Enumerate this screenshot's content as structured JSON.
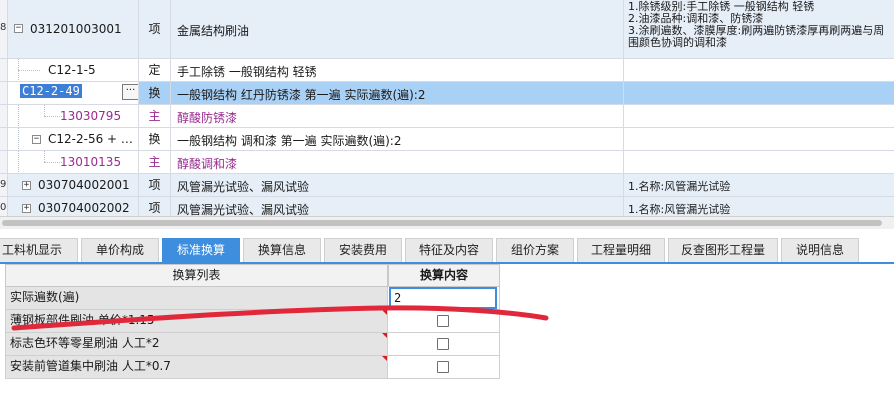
{
  "table": {
    "rows": [
      {
        "idx": "8",
        "code": "031201003001",
        "type": "项",
        "name": "金属结构刷油",
        "desc": "1.除锈级别:手工除锈 一般钢结构 轻锈\n2.油漆品种:调和漆、防锈漆\n3.涂刷遍数、漆膜厚度:刷两遍防锈漆厚再刷两遍与周围颜色协调的调和漆"
      },
      {
        "idx": "",
        "code": "C12-1-5",
        "type": "定",
        "name": "手工除锈 一般钢结构 轻锈",
        "desc": ""
      },
      {
        "idx": "",
        "code": "C12-2-49",
        "type": "换",
        "name": "一般钢结构 红丹防锈漆 第一遍  实际遍数(遍):2",
        "desc": ""
      },
      {
        "idx": "",
        "code": "13030795",
        "type": "主",
        "name": "醇酸防锈漆",
        "desc": ""
      },
      {
        "idx": "",
        "code": "C12-2-56 + …",
        "type": "换",
        "name": "一般钢结构 调和漆 第一遍  实际遍数(遍):2",
        "desc": ""
      },
      {
        "idx": "",
        "code": "13010135",
        "type": "主",
        "name": "醇酸调和漆",
        "desc": ""
      },
      {
        "idx": "9",
        "code": "030704002001",
        "type": "项",
        "name": "风管漏光试验、漏风试验",
        "desc": "1.名称:风管漏光试验"
      },
      {
        "idx": "0",
        "code": "030704002002",
        "type": "项",
        "name": "风管漏光试验、漏风试验",
        "desc": "1.名称:风管漏光试验"
      }
    ],
    "ellipsis": "···"
  },
  "tabs": [
    "工料机显示",
    "单价构成",
    "标准换算",
    "换算信息",
    "安装费用",
    "特征及内容",
    "组价方案",
    "工程量明细",
    "反查图形工程量",
    "说明信息"
  ],
  "active_tab": 2,
  "conversion": {
    "header_list": "换算列表",
    "header_content": "换算内容",
    "rows": [
      {
        "label": "实际遍数(遍)",
        "value": "2"
      },
      {
        "label": "薄钢板部件刷油 单价*1.15",
        "value": ""
      },
      {
        "label": "标志色环等零星刷油 人工*2",
        "value": ""
      },
      {
        "label": "安装前管道集中刷油 人工*0.7",
        "value": ""
      }
    ]
  },
  "colors": {
    "accent": "#3d8ede",
    "selected_row": "#a9d0f5",
    "main_material": "#9a2b8f",
    "annotation": "#e0283a"
  }
}
